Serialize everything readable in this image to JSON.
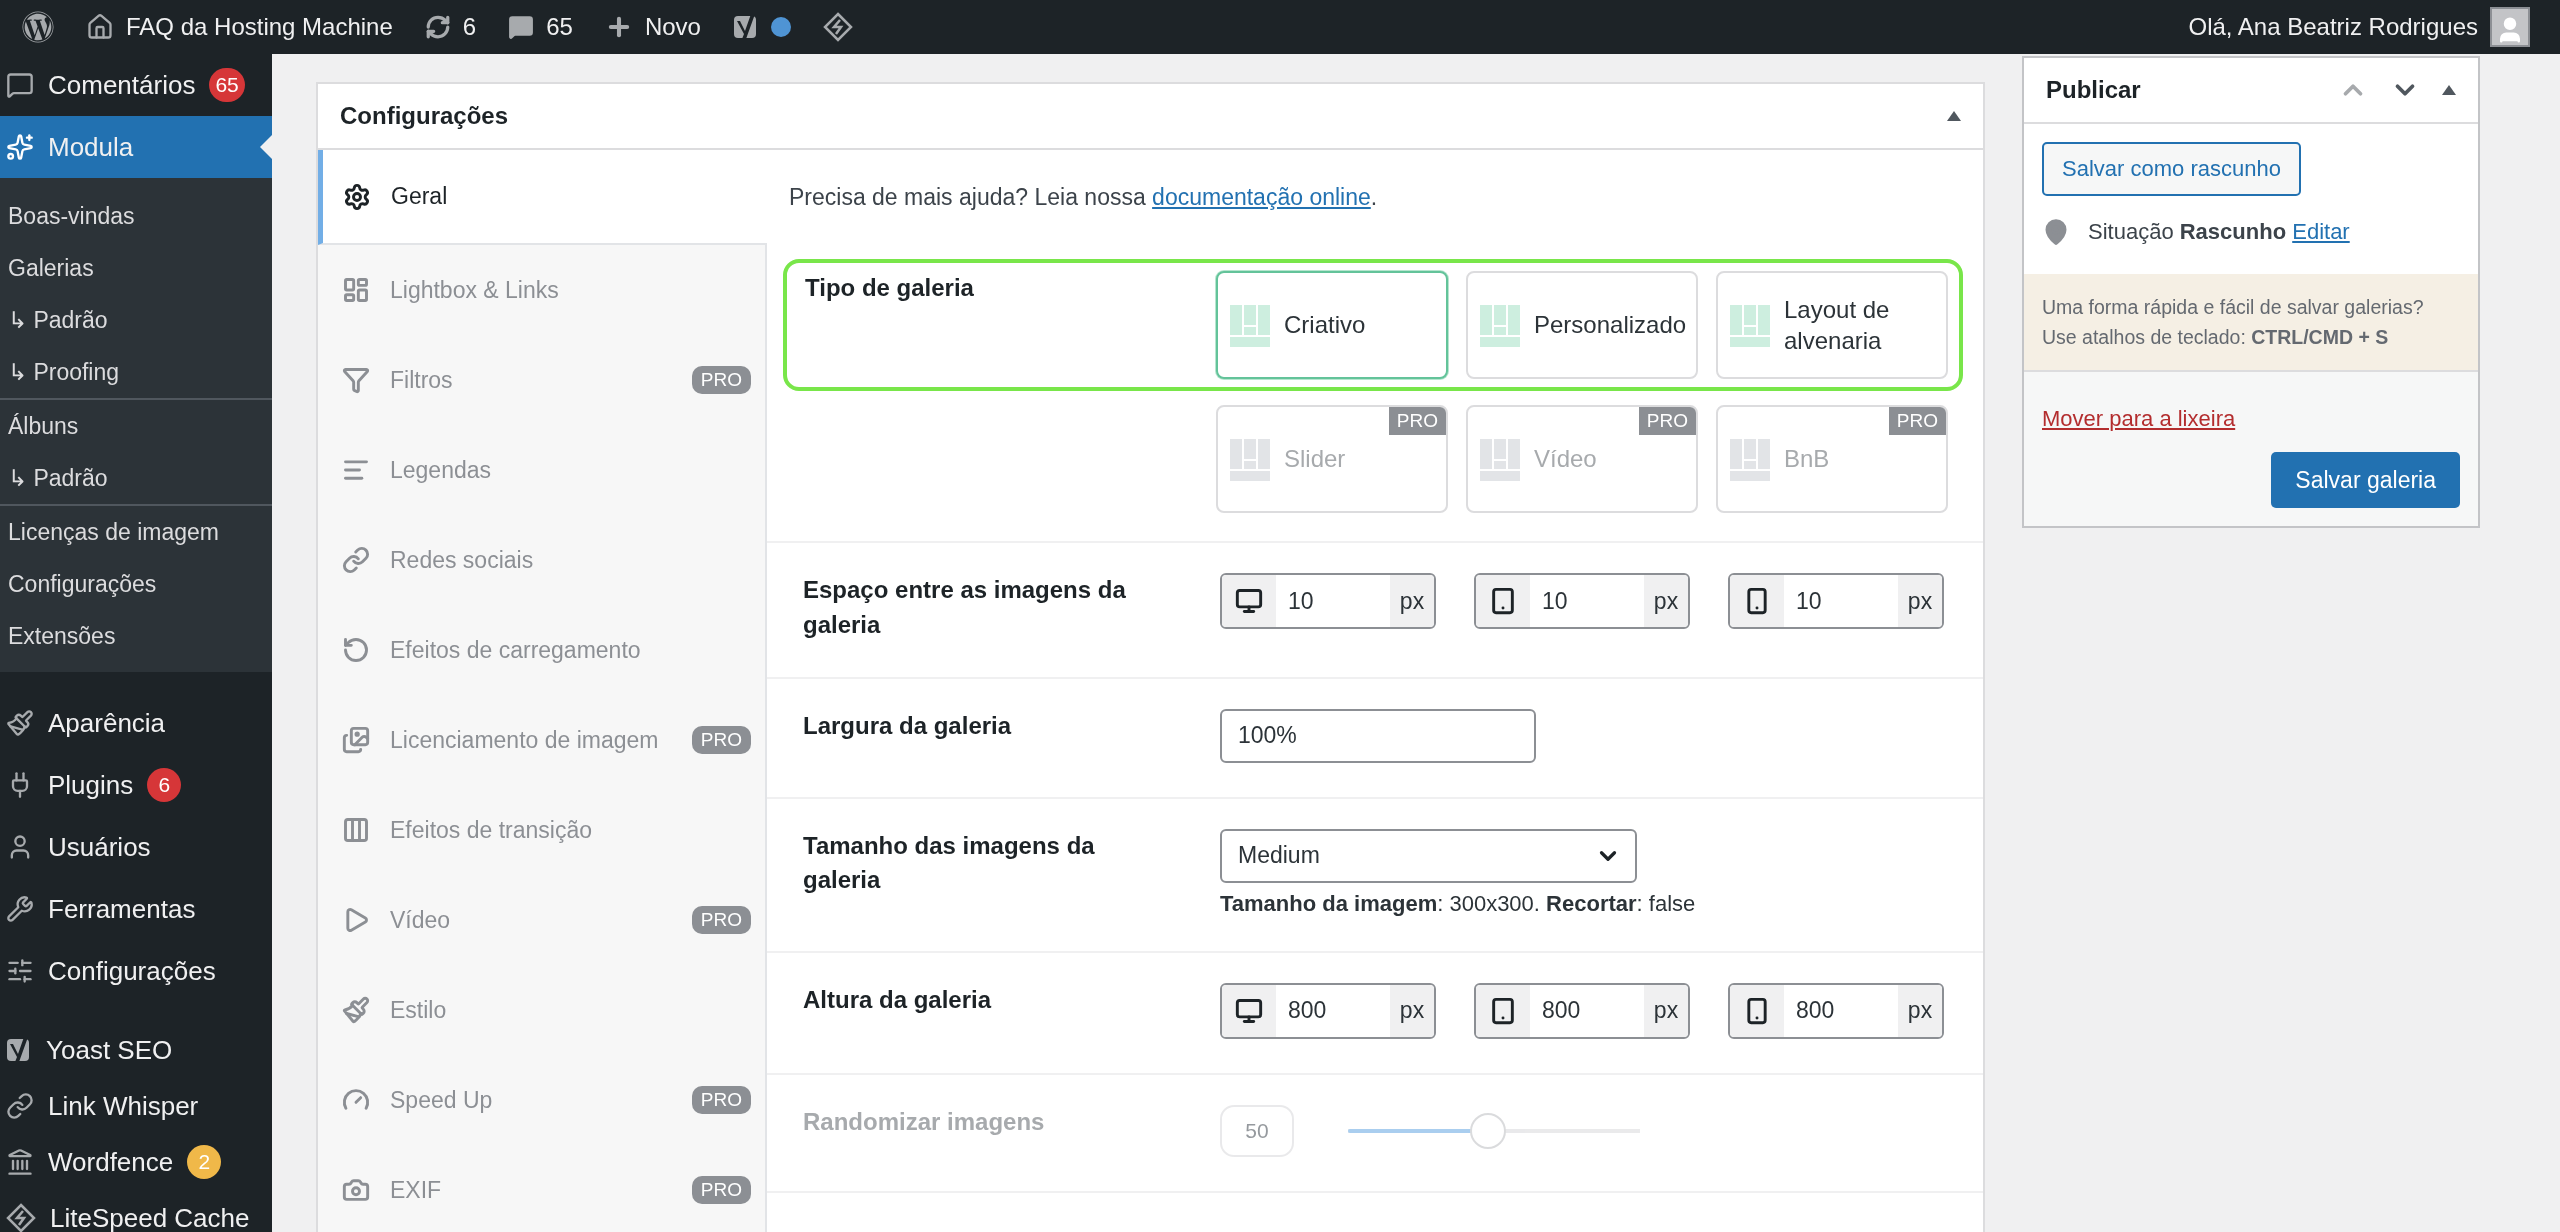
{
  "admin_bar": {
    "site_name": "FAQ da Hosting Machine",
    "updates": "6",
    "comments": "65",
    "new_label": "Novo",
    "greeting": "Olá, Ana Beatriz Rodrigues"
  },
  "sidebar": {
    "groups": [
      [
        {
          "label": "Comentários",
          "badge": "65",
          "color": "#d63638",
          "selected": false
        },
        {
          "label": "Modula",
          "selected": true,
          "submenu": [
            [
              "Boas-vindas",
              "Galerias",
              "↳ Padrão",
              "↳ Proofing"
            ],
            [
              "Álbuns",
              "↳ Padrão"
            ],
            [
              "Licenças de imagem",
              "Configurações",
              "Extensões"
            ]
          ]
        }
      ],
      [
        {
          "label": "Aparência",
          "selected": false
        },
        {
          "label": "Plugins",
          "badge": "6",
          "color": "#d63638",
          "selected": false
        },
        {
          "label": "Usuários",
          "selected": false
        },
        {
          "label": "Ferramentas",
          "selected": false
        },
        {
          "label": "Configurações",
          "selected": false
        }
      ],
      [
        {
          "label": "Yoast SEO",
          "selected": false
        },
        {
          "label": "Link Whisper",
          "selected": false
        },
        {
          "label": "Wordfence",
          "badge": "2",
          "color": "#f0b849",
          "selected": false
        },
        {
          "label": "LiteSpeed Cache",
          "selected": false
        }
      ]
    ]
  },
  "settings": {
    "title": "Configurações",
    "tabs": [
      {
        "label": "Geral",
        "selected": true
      },
      {
        "label": "Lightbox & Links",
        "selected": false
      },
      {
        "label": "Filtros",
        "selected": false,
        "badge": "PRO"
      },
      {
        "label": "Legendas",
        "selected": false
      },
      {
        "label": "Redes sociais",
        "selected": false
      },
      {
        "label": "Efeitos de carregamento",
        "selected": false
      },
      {
        "label": "Licenciamento de imagem",
        "selected": false,
        "badge": "PRO"
      },
      {
        "label": "Efeitos de transição",
        "selected": false
      },
      {
        "label": "Vídeo",
        "selected": false,
        "badge": "PRO"
      },
      {
        "label": "Estilo",
        "selected": false
      },
      {
        "label": "Speed Up",
        "selected": false,
        "badge": "PRO"
      },
      {
        "label": "EXIF",
        "selected": false,
        "badge": "PRO"
      }
    ],
    "help": {
      "text": "Precisa de mais ajuda? Leia nossa",
      "link": "documentação online",
      "end": "."
    },
    "gallery_type": {
      "label": "Tipo de galeria",
      "options": [
        {
          "label": "Criativo",
          "selected": true,
          "disabled": false
        },
        {
          "label": "Personalizado",
          "selected": false,
          "disabled": false
        },
        {
          "label": "Layout de alvenaria",
          "selected": false,
          "disabled": false
        },
        {
          "label": "Slider",
          "selected": false,
          "disabled": true,
          "badge": "PRO"
        },
        {
          "label": "Vídeo",
          "selected": false,
          "disabled": true,
          "badge": "PRO"
        },
        {
          "label": "BnB",
          "selected": false,
          "disabled": true,
          "badge": "PRO"
        }
      ]
    },
    "spacing": {
      "label": "Espaço entre as imagens da galeria",
      "inputs": [
        {
          "kind": "desktop",
          "value": "10",
          "unit": "px"
        },
        {
          "kind": "tablet",
          "value": "10",
          "unit": "px"
        },
        {
          "kind": "mobile",
          "value": "10",
          "unit": "px"
        }
      ]
    },
    "width": {
      "label": "Largura da galeria",
      "value": "100%"
    },
    "image_size": {
      "label": "Tamanho das imagens da galeria",
      "value": "Medium",
      "note": "**Tamanho da imagem**: 300x300. **Recortar**: false"
    },
    "height": {
      "label": "Altura da galeria",
      "inputs": [
        {
          "kind": "desktop",
          "value": "800",
          "unit": "px"
        },
        {
          "kind": "tablet",
          "value": "800",
          "unit": "px"
        },
        {
          "kind": "mobile",
          "value": "800",
          "unit": "px"
        }
      ]
    },
    "randomize": {
      "label": "Randomizar imagens",
      "value": "50",
      "level": 0.48,
      "disabled": true
    }
  },
  "publish": {
    "title": "Publicar",
    "save_draft": "Salvar como rascunho",
    "status": "Situação **Rascunho**",
    "edit": "Editar",
    "notice": "Uma forma rápida e fácil de salvar galerias? Use atalhos de teclado: **CTRL/CMD + S**",
    "trash": "Mover para a lixeira",
    "submit": "Salvar galeria"
  }
}
